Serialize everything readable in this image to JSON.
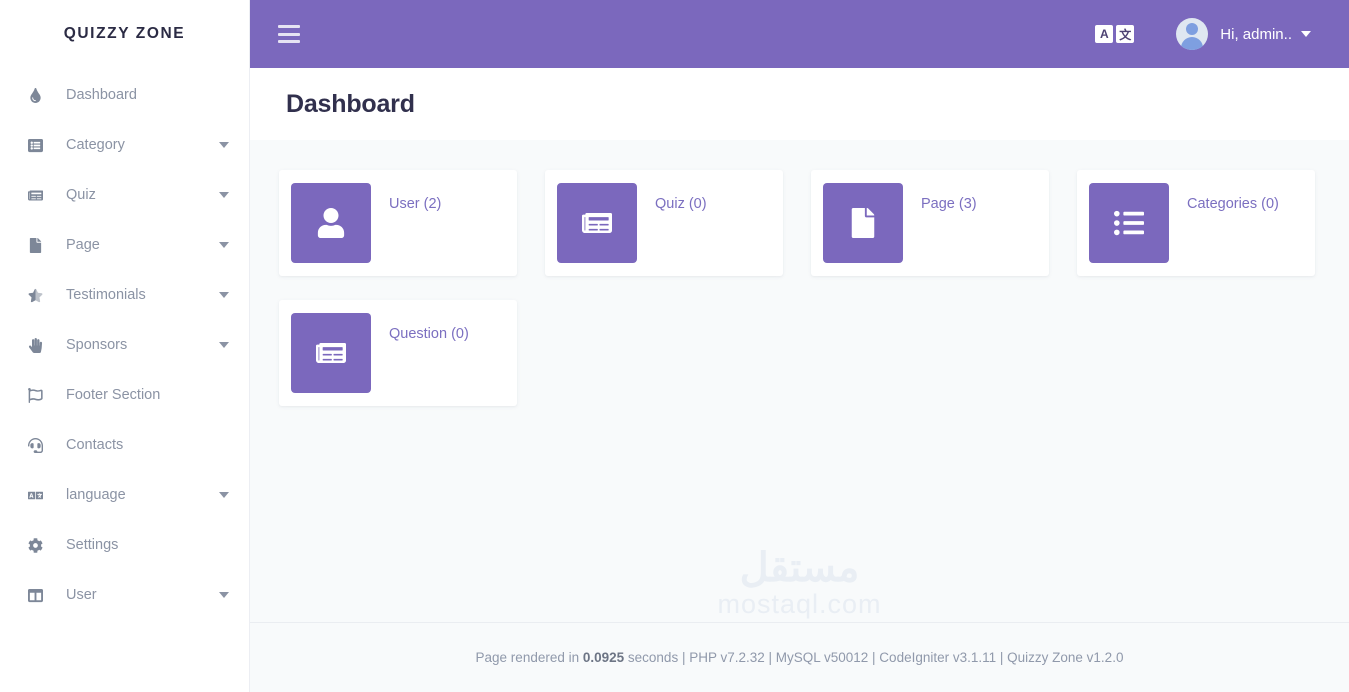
{
  "sidebar": {
    "brand": "QUIZZY ZONE",
    "items": [
      {
        "label": "Dashboard",
        "icon": "droplet-icon",
        "caret": false
      },
      {
        "label": "Category",
        "icon": "list-alt-icon",
        "caret": true
      },
      {
        "label": "Quiz",
        "icon": "newspaper-icon",
        "caret": true
      },
      {
        "label": "Page",
        "icon": "file-icon",
        "caret": true
      },
      {
        "label": "Testimonials",
        "icon": "star-half-icon",
        "caret": true
      },
      {
        "label": "Sponsors",
        "icon": "hand-icon",
        "caret": true
      },
      {
        "label": "Footer Section",
        "icon": "flag-icon",
        "caret": false
      },
      {
        "label": "Contacts",
        "icon": "headset-icon",
        "caret": false
      },
      {
        "label": "language",
        "icon": "language-icon",
        "caret": true
      },
      {
        "label": "Settings",
        "icon": "gear-icon",
        "caret": false
      },
      {
        "label": "User",
        "icon": "columns-icon",
        "caret": true
      }
    ]
  },
  "topbar": {
    "menu_icon": "hamburger-icon",
    "translate_icon": "translate-icon",
    "translate_left": "A",
    "translate_right": "文",
    "avatar_icon": "user-avatar-icon",
    "user_label": "Hi, admin..",
    "user_caret_icon": "chevron-down-icon"
  },
  "page": {
    "title": "Dashboard"
  },
  "cards": [
    {
      "label": "User (2)",
      "icon": "user-icon"
    },
    {
      "label": "Quiz (0)",
      "icon": "newspaper-icon"
    },
    {
      "label": "Page (3)",
      "icon": "file-icon"
    },
    {
      "label": "Categories (0)",
      "icon": "list-ul-icon"
    },
    {
      "label": "Question (0)",
      "icon": "newspaper-icon"
    }
  ],
  "watermark": {
    "arabic": "مستقل",
    "latin": "mostaql.com"
  },
  "footer": {
    "prefix": "Page rendered in ",
    "render_time": "0.0925",
    "suffix": " seconds | PHP v7.2.32 | MySQL v50012 | CodeIgniter v3.1.11 | Quizzy Zone v1.2.0"
  },
  "colors": {
    "accent": "#7b68bd",
    "card_label": "#7b6fc0",
    "sidebar_text": "#8b93a4",
    "title": "#31304d",
    "content_bg": "#f8fafb"
  }
}
